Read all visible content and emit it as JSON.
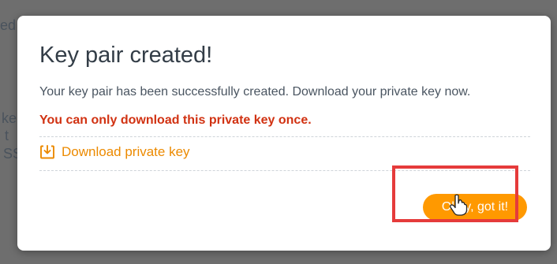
{
  "background": {
    "fragments": [
      "ed",
      "ke",
      "t",
      "SS"
    ]
  },
  "dialog": {
    "title": "Key pair created!",
    "description": "Your key pair has been successfully created. Download your private key now.",
    "warning": "You can only download this private key once.",
    "download_link": "Download private key",
    "confirm_button": "Okay, got it!"
  },
  "icons": {
    "download": "download-icon",
    "cursor": "hand-cursor-icon"
  },
  "colors": {
    "accent": "#ff9900",
    "link": "#ec8a00",
    "warning": "#d13212",
    "highlight": "#e53b3b"
  }
}
